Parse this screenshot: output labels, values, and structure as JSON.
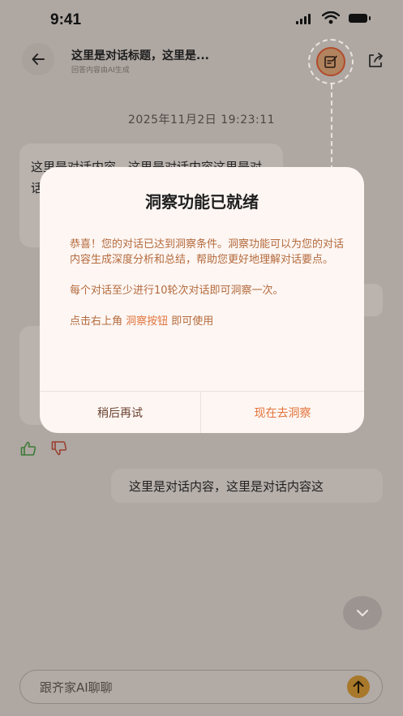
{
  "status_bar": {
    "time": "9:41"
  },
  "header": {
    "title": "这里是对话标题，这里是...",
    "subtitle": "回答内容由AI生成"
  },
  "chat": {
    "timestamp": "2025年11月2日  19:23:11",
    "message_1": "这里是对话内容，这里是对话内容这里是对话内容这里是对话内容这里是对话内容",
    "message_user": "这里是对话内容，这里是对话内容这"
  },
  "input": {
    "placeholder": "跟齐家AI聊聊"
  },
  "modal": {
    "title": "洞察功能已就绪",
    "p1": "恭喜！您的对话已达到洞察条件。洞察功能可以为您的对话内容生成深度分析和总结，帮助您更好地理解对话要点。",
    "p2": "每个对话至少进行10轮次对话即可洞察一次。",
    "p3_prefix": "点击右上角 ",
    "p3_highlight": "洞察按钮",
    "p3_suffix": " 即可使用",
    "later_label": "稍后再试",
    "now_label": "现在去洞察"
  },
  "colors": {
    "accent": "#e3733a",
    "body_text": "#b46a3c",
    "modal_bg": "#fdf6f3",
    "send_button": "#a8782b"
  },
  "icons": {
    "back": "arrow-left-icon",
    "insight": "edit-note-icon",
    "share": "share-icon",
    "like": "thumbs-up-icon",
    "dislike": "thumbs-down-icon",
    "scroll": "chevron-down-icon",
    "send": "arrow-up-icon"
  }
}
